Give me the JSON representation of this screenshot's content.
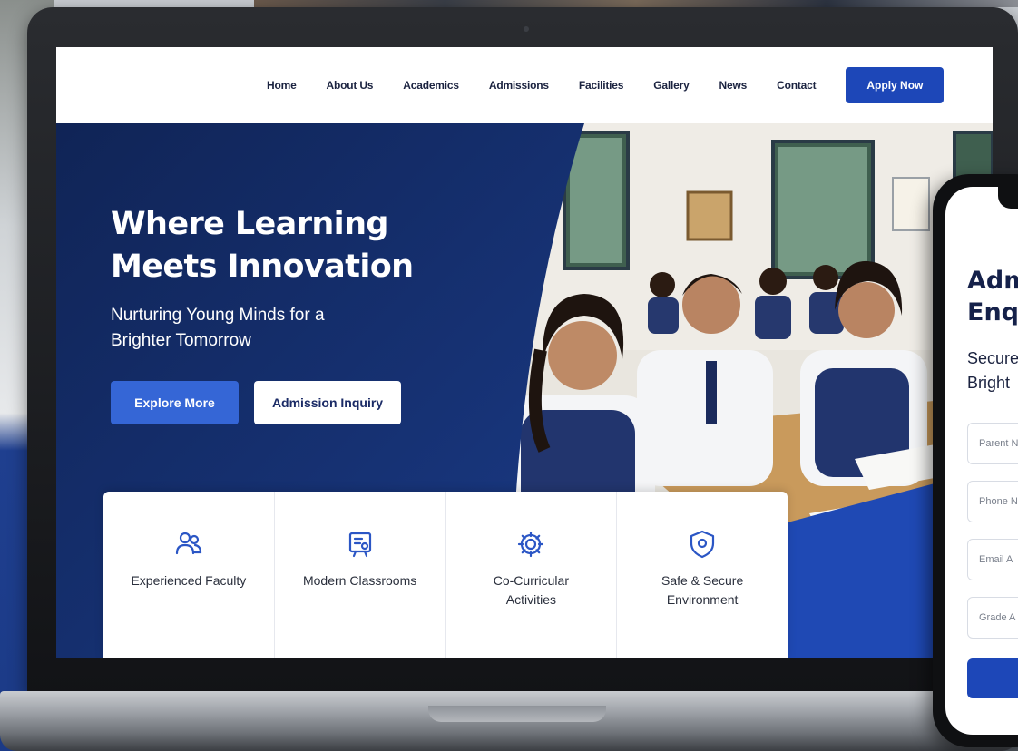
{
  "colors": {
    "primary": "#1d47b8",
    "hero_navy": "#13295f",
    "text_dark": "#1b2340",
    "icon_blue": "#2b56c5"
  },
  "nav": {
    "links": [
      "Home",
      "About Us",
      "Academics",
      "Admissions",
      "Facilities",
      "Gallery",
      "News",
      "Contact"
    ],
    "cta_label": "Apply Now"
  },
  "hero": {
    "title_line1": "Where Learning",
    "title_line2": "Meets Innovation",
    "subtitle": "Nurturing Young Minds for a Brighter Tomorrow",
    "primary_button": "Explore More",
    "secondary_button": "Admission Inquiry"
  },
  "features": [
    {
      "icon": "people-icon",
      "label": "Experienced Faculty"
    },
    {
      "icon": "classroom-board-icon",
      "label": "Modern Classrooms"
    },
    {
      "icon": "gear-icon",
      "label": "Co-Curricular Activities"
    },
    {
      "icon": "shield-icon",
      "label": "Safe & Secure Environment"
    }
  ],
  "phone_form": {
    "title": "Adm\nEnq",
    "subtitle": "Secure\nBright",
    "fields": [
      {
        "placeholder": "Parent N"
      },
      {
        "placeholder": "Phone N"
      },
      {
        "placeholder": "Email A"
      },
      {
        "placeholder": "Grade A"
      }
    ]
  }
}
